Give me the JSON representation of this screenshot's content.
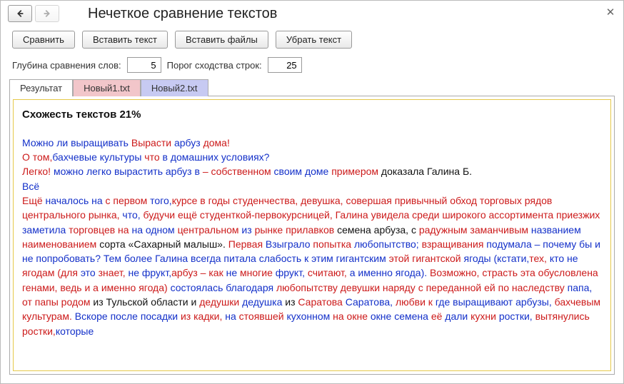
{
  "title": "Нечеткое сравнение текстов",
  "nav": {
    "back_enabled": true,
    "forward_enabled": false
  },
  "toolbar": {
    "compare": "Сравнить",
    "paste_text": "Вставить текст",
    "paste_files": "Вставить файлы",
    "clear": "Убрать текст"
  },
  "params": {
    "depth_label": "Глубина сравнения слов:",
    "depth_value": "5",
    "threshold_label": "Порог сходства строк:",
    "threshold_value": "25"
  },
  "tabs": {
    "result": "Результат",
    "file1": "Новый1.txt",
    "file2": "Новый2.txt"
  },
  "result": {
    "heading": "Схожесть текстов 21%",
    "spans": [
      {
        "c": "b",
        "t": "Можно ли выращивать "
      },
      {
        "c": "r",
        "t": "Вырасти "
      },
      {
        "c": "b",
        "t": "арбуз "
      },
      {
        "c": "r",
        "t": "дома!"
      },
      {
        "c": "nl"
      },
      {
        "c": "r",
        "t": "О том,"
      },
      {
        "c": "b",
        "t": "бахчевые культуры "
      },
      {
        "c": "r",
        "t": "что "
      },
      {
        "c": "b",
        "t": "в домашних условиях?"
      },
      {
        "c": "nl"
      },
      {
        "c": "r",
        "t": "Легко! "
      },
      {
        "c": "b",
        "t": "можно легко вырастить арбуз в "
      },
      {
        "c": "r",
        "t": "– собственном "
      },
      {
        "c": "b",
        "t": "своим доме "
      },
      {
        "c": "r",
        "t": "примером "
      },
      {
        "c": "k",
        "t": "доказала Галина Б."
      },
      {
        "c": "nl"
      },
      {
        "c": "b",
        "t": "Всё"
      },
      {
        "c": "nl"
      },
      {
        "c": "r",
        "t": "Ещё "
      },
      {
        "c": "b",
        "t": "началось на "
      },
      {
        "c": "r",
        "t": "с первом "
      },
      {
        "c": "b",
        "t": "того,"
      },
      {
        "c": "r",
        "t": "курсе в годы студенчества, девушка, совершая привычный обход торговых рядов центрального рынка, "
      },
      {
        "c": "b",
        "t": "что, "
      },
      {
        "c": "r",
        "t": "будучи ещё студенткой-первокурсницей, Галина увидела среди широкого ассортимента приезжих "
      },
      {
        "c": "b",
        "t": "заметила "
      },
      {
        "c": "r",
        "t": "торговцев на "
      },
      {
        "c": "b",
        "t": "на одном "
      },
      {
        "c": "r",
        "t": "центральном "
      },
      {
        "c": "b",
        "t": "из "
      },
      {
        "c": "r",
        "t": "рынке прилавков "
      },
      {
        "c": "k",
        "t": "семена арбуза, с "
      },
      {
        "c": "r",
        "t": "радужным заманчивым "
      },
      {
        "c": "b",
        "t": "названием "
      },
      {
        "c": "r",
        "t": "наименованием "
      },
      {
        "c": "k",
        "t": "сорта «Сахарный малыш». "
      },
      {
        "c": "r",
        "t": "Первая "
      },
      {
        "c": "b",
        "t": "Взыграло "
      },
      {
        "c": "r",
        "t": "попытка "
      },
      {
        "c": "b",
        "t": "любопытство; "
      },
      {
        "c": "r",
        "t": "взращивания "
      },
      {
        "c": "b",
        "t": "подумала – почему бы и не попробовать? Тем более Галина всегда питала слабость к этим гигантским "
      },
      {
        "c": "r",
        "t": "этой гигантской "
      },
      {
        "c": "b",
        "t": "ягоды (кстати,"
      },
      {
        "c": "r",
        "t": "тех, "
      },
      {
        "c": "b",
        "t": "кто не "
      },
      {
        "c": "r",
        "t": "ягодам (для "
      },
      {
        "c": "b",
        "t": "это "
      },
      {
        "c": "r",
        "t": "знает, "
      },
      {
        "c": "b",
        "t": "не фрукт,"
      },
      {
        "c": "r",
        "t": "арбуз – как "
      },
      {
        "c": "b",
        "t": "не "
      },
      {
        "c": "r",
        "t": "многие "
      },
      {
        "c": "b",
        "t": "фрукт, "
      },
      {
        "c": "r",
        "t": "считают, "
      },
      {
        "c": "b",
        "t": "а именно ягода). "
      },
      {
        "c": "r",
        "t": "Возможно, страсть эта обусловлена генами, ведь и а именно ягода) "
      },
      {
        "c": "b",
        "t": "состоялась благодаря "
      },
      {
        "c": "r",
        "t": "любопытству девушки наряду с переданной ей по наследству "
      },
      {
        "c": "b",
        "t": "папа, "
      },
      {
        "c": "r",
        "t": "от папы родом "
      },
      {
        "c": "k",
        "t": "из Тульской области и "
      },
      {
        "c": "r",
        "t": "дедушки "
      },
      {
        "c": "b",
        "t": "дедушка "
      },
      {
        "c": "k",
        "t": "из "
      },
      {
        "c": "r",
        "t": "Саратова "
      },
      {
        "c": "b",
        "t": "Саратова, "
      },
      {
        "c": "r",
        "t": "любви к "
      },
      {
        "c": "b",
        "t": "где выращивают арбузы, "
      },
      {
        "c": "r",
        "t": "бахчевым культурам. "
      },
      {
        "c": "b",
        "t": "Вскоре после посадки "
      },
      {
        "c": "r",
        "t": "из кадки, "
      },
      {
        "c": "b",
        "t": "на "
      },
      {
        "c": "r",
        "t": "стоявшей "
      },
      {
        "c": "b",
        "t": "кухонном "
      },
      {
        "c": "r",
        "t": "на окне "
      },
      {
        "c": "b",
        "t": "окне семена "
      },
      {
        "c": "r",
        "t": "её "
      },
      {
        "c": "b",
        "t": "дали "
      },
      {
        "c": "r",
        "t": "кухни "
      },
      {
        "c": "b",
        "t": "ростки, "
      },
      {
        "c": "r",
        "t": "вытянулись ростки,"
      },
      {
        "c": "b",
        "t": "которые"
      }
    ]
  }
}
